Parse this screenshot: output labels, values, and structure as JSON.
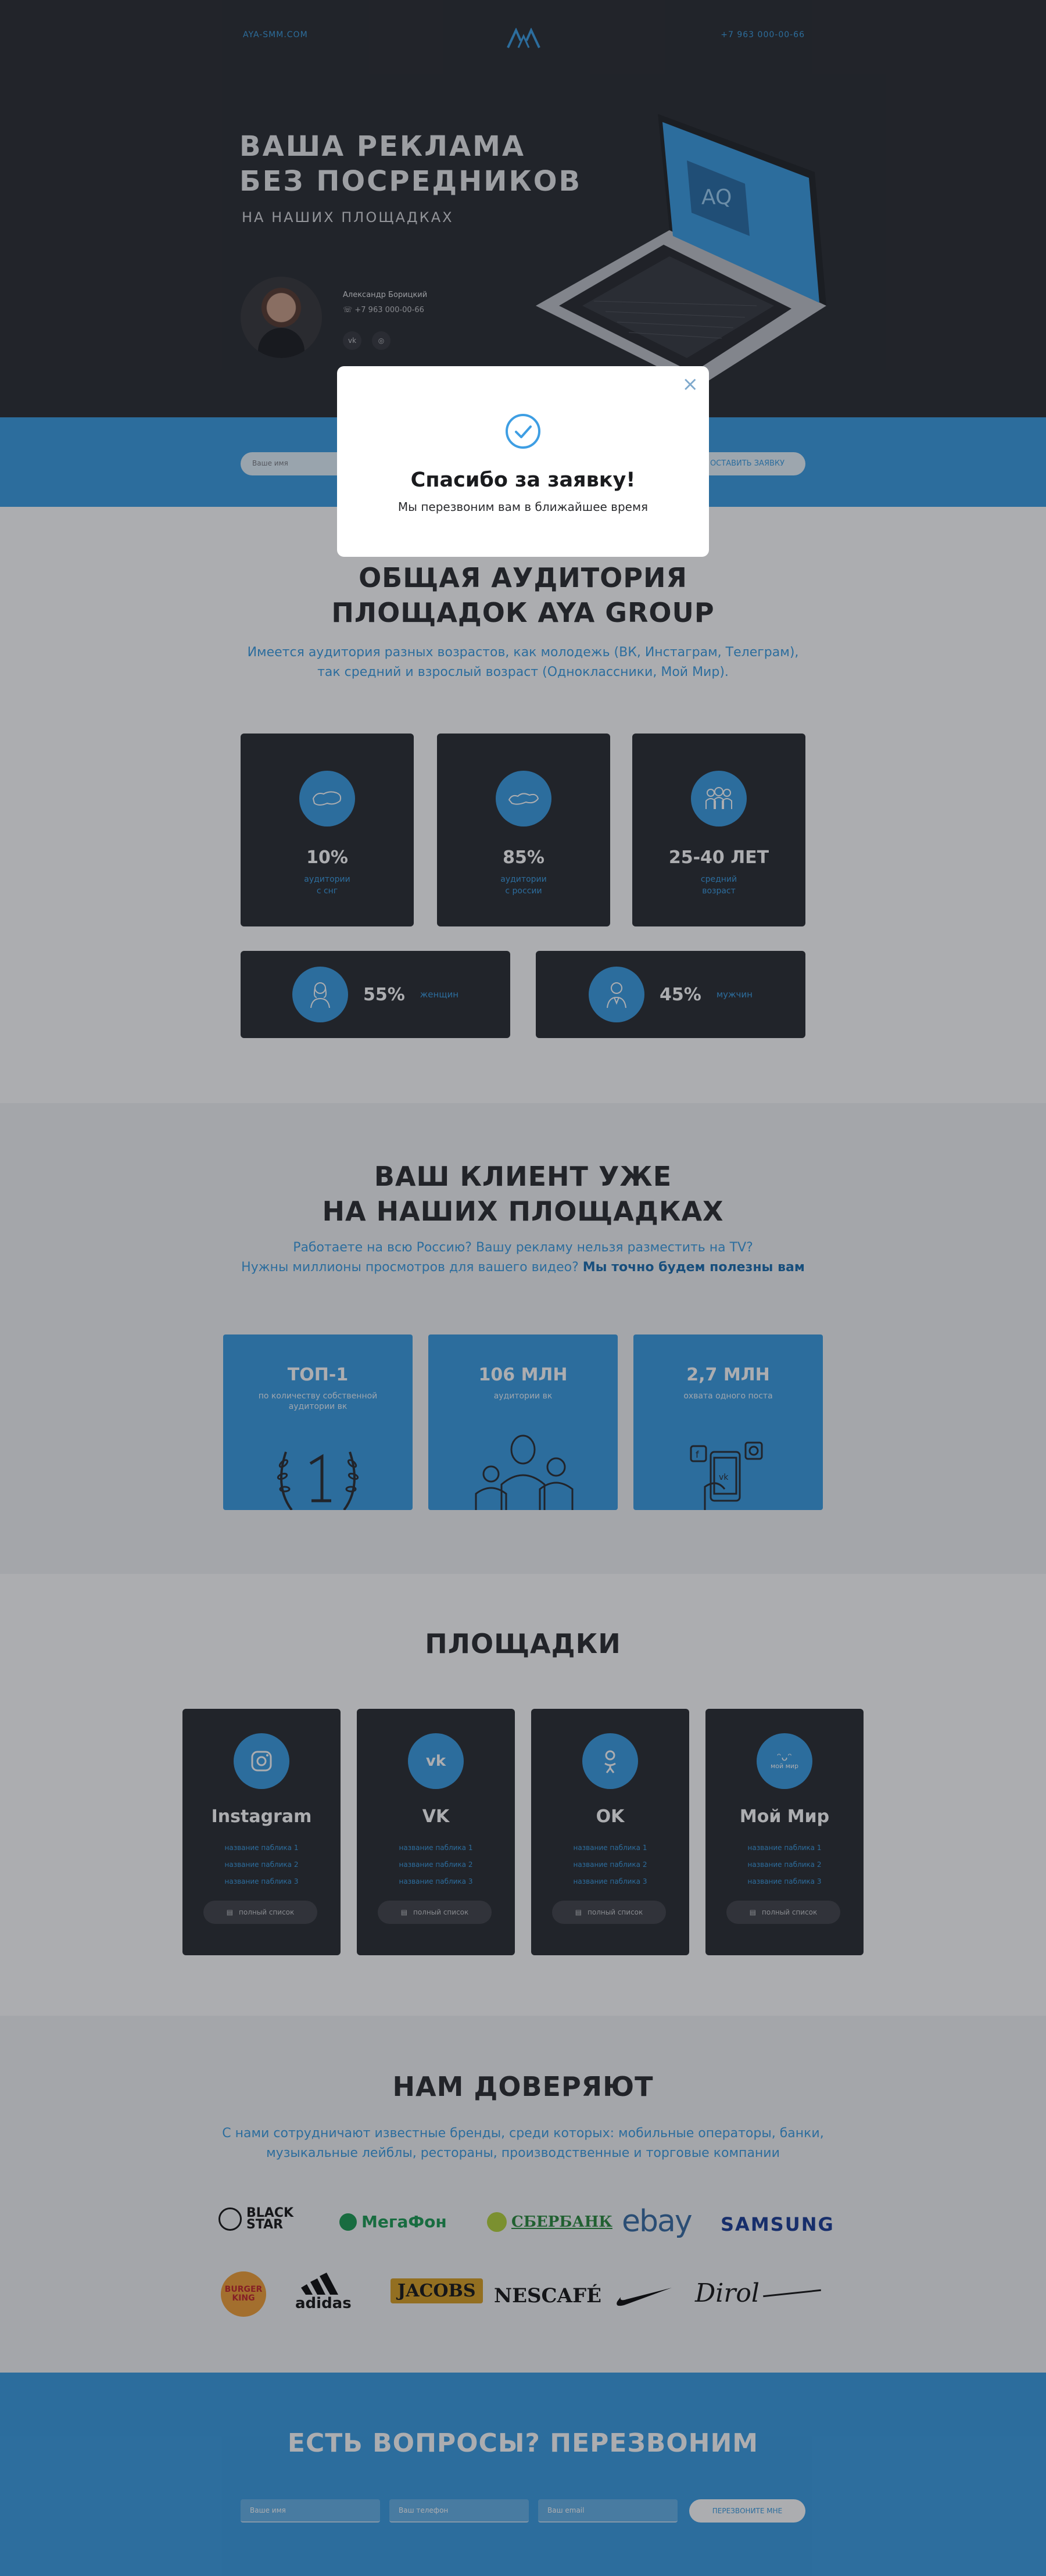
{
  "colors": {
    "accent": "#3e9ee3",
    "dark": "#2d2f34",
    "light": "#f3f4f6"
  },
  "header": {
    "site": "AYA-SMM.COM",
    "phone": "+7 963 000-00-66",
    "logo_icon": "aya-logo-icon"
  },
  "hero": {
    "title_line1": "ВАША РЕКЛАМА",
    "title_line2": "БЕЗ ПОСРЕДНИКОВ",
    "subtitle": "НА НАШИХ ПЛОЩАДКАХ",
    "manager_name": "Александр Борицкий",
    "manager_phone": "+7 963 000-00-66",
    "social": [
      "vk-icon",
      "odnoklassniki-icon"
    ],
    "laptop_screen_text": "AQ"
  },
  "form": {
    "name_placeholder": "Ваше имя",
    "submit_label": "ОСТАВИТЬ ЗАЯВКУ"
  },
  "audience": {
    "title_line1": "ОБЩАЯ АУДИТОРИЯ",
    "title_line2": "ПЛОЩАДОК AYA GROUP",
    "text_line1": "Имеется аудитория разных возрастов, как молодежь (ВК, Инстаграм, Телеграм),",
    "text_line2": "так средний и взрослый возраст (Одноклассники, Мой Мир).",
    "stats": [
      {
        "value": "10%",
        "label_line1": "аудитории",
        "label_line2": "с снг",
        "icon": "map-cis-icon"
      },
      {
        "value": "85%",
        "label_line1": "аудитории",
        "label_line2": "с россии",
        "icon": "map-russia-icon"
      },
      {
        "value": "25-40 ЛЕТ",
        "label_line1": "средний",
        "label_line2": "возраст",
        "icon": "people-group-icon"
      }
    ],
    "gender": [
      {
        "value": "55%",
        "label": "женщин",
        "icon": "woman-icon"
      },
      {
        "value": "45%",
        "label": "мужчин",
        "icon": "man-icon"
      }
    ]
  },
  "clients": {
    "title_line1": "ВАШ КЛИЕНТ УЖЕ",
    "title_line2": "НА НАШИХ ПЛОЩАДКАХ",
    "text_line1": "Работаете на всю Россию? Вашу рекламу нельзя разместить на TV?",
    "text_line2": "Нужны миллионы просмотров для вашего видео?",
    "text_bold": "Мы точно будем полезны вам",
    "cards": [
      {
        "value": "ТОП-1",
        "label": "по количеству собственной аудитории вк",
        "icon": "laurel-one-icon"
      },
      {
        "value": "106 МЛН",
        "label": "аудитории вк",
        "icon": "crowd-icon"
      },
      {
        "value": "2,7 МЛН",
        "label": "охвата одного поста",
        "icon": "phone-social-icon"
      }
    ]
  },
  "platforms": {
    "title": "ПЛОЩАДКИ",
    "button_label": "полный список",
    "cards": [
      {
        "name": "Instagram",
        "icon": "instagram-icon",
        "items": [
          "название паблика 1",
          "название паблика 2",
          "название паблика 3"
        ]
      },
      {
        "name": "VK",
        "icon": "vk-icon",
        "items": [
          "название паблика 1",
          "название паблика 2",
          "название паблика 3"
        ]
      },
      {
        "name": "OK",
        "icon": "odnoklassniki-icon",
        "items": [
          "название паблика 1",
          "название паблика 2",
          "название паблика 3"
        ]
      },
      {
        "name": "Мой Мир",
        "icon": "moy-mir-icon",
        "icon_text": "мой мир",
        "items": [
          "название паблика 1",
          "название паблика 2",
          "название паблика 3"
        ]
      }
    ]
  },
  "trust": {
    "title": "НАМ ДОВЕРЯЮТ",
    "text_line1": "С нами сотрудничают известные бренды, среди которых: мобильные операторы, банки,",
    "text_line2": "музыкальные лейблы, рестораны, производственные и торговые компании",
    "brands_row1": [
      "BLACK STAR",
      "МегаФон",
      "СБЕРБАНК",
      "ebay",
      "SAMSUNG"
    ],
    "brands_row2": [
      "BURGER KING",
      "adidas",
      "JACOBS",
      "NESCAFÉ",
      "nike",
      "Dirol"
    ]
  },
  "callback": {
    "title": "ЕСТЬ ВОПРОСЫ? ПЕРЕЗВОНИМ",
    "name_placeholder": "Ваше имя",
    "phone_placeholder": "Ваш телефон",
    "email_placeholder": "Ваш email",
    "submit_label": "ПЕРЕЗВОНИТЕ МНЕ"
  },
  "modal": {
    "title": "Спасибо за заявку!",
    "text": "Мы перезвоним вам в ближайшее время",
    "close_symbol": "×"
  }
}
